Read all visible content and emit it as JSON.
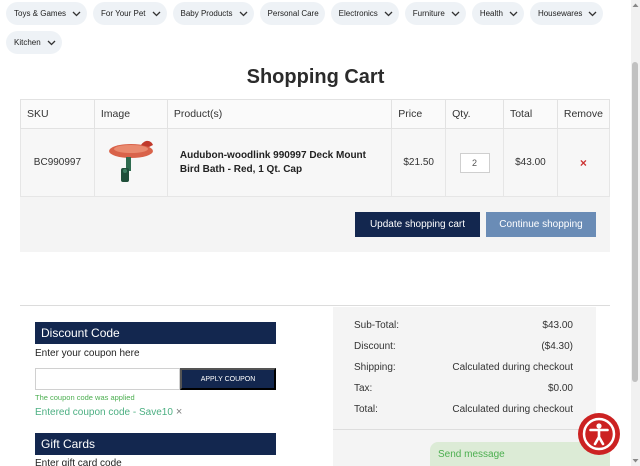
{
  "categories": [
    {
      "label": "Toys & Games"
    },
    {
      "label": "For Your Pet"
    },
    {
      "label": "Baby Products"
    },
    {
      "label": "Personal Care"
    },
    {
      "label": "Electronics"
    },
    {
      "label": "Furniture"
    },
    {
      "label": "Health"
    },
    {
      "label": "Housewares"
    },
    {
      "label": "Kitchen"
    }
  ],
  "page_title": "Shopping Cart",
  "cart": {
    "headers": {
      "sku": "SKU",
      "image": "Image",
      "product": "Product(s)",
      "price": "Price",
      "qty": "Qty.",
      "total": "Total",
      "remove": "Remove"
    },
    "items": [
      {
        "sku": "BC990997",
        "image_icon": "bird-bath-product-image",
        "product": "Audubon-woodlink 990997 Deck Mount Bird Bath - Red, 1 Qt. Cap",
        "price": "$21.50",
        "qty": "2",
        "total": "$43.00",
        "remove_symbol": "×"
      }
    ],
    "update_label": "Update shopping cart",
    "continue_label": "Continue shopping"
  },
  "discount": {
    "title": "Discount Code",
    "prompt": "Enter your coupon here",
    "input_value": "",
    "apply_label": "APPLY COUPON",
    "applied_message": "The coupon code was applied",
    "entered_text": "Entered coupon code - Save10",
    "remove_symbol": "×"
  },
  "gift_cards": {
    "title": "Gift Cards",
    "prompt": "Enter gift card code"
  },
  "totals": {
    "subtotal_label": "Sub-Total:",
    "subtotal_value": "$43.00",
    "discount_label": "Discount:",
    "discount_value": "($4.30)",
    "shipping_label": "Shipping:",
    "shipping_value": "Calculated during checkout",
    "tax_label": "Tax:",
    "tax_value": "$0.00",
    "total_label": "Total:",
    "total_value": "Calculated during checkout"
  },
  "widgets": {
    "send_message": "Send message",
    "accessibility_icon": "accessibility-icon"
  },
  "colors": {
    "navy": "#13274f",
    "steel_blue": "#6a8cb6",
    "success_green": "#4caf50",
    "remove_red": "#cc3333",
    "accessibility_red": "#cc2222"
  }
}
